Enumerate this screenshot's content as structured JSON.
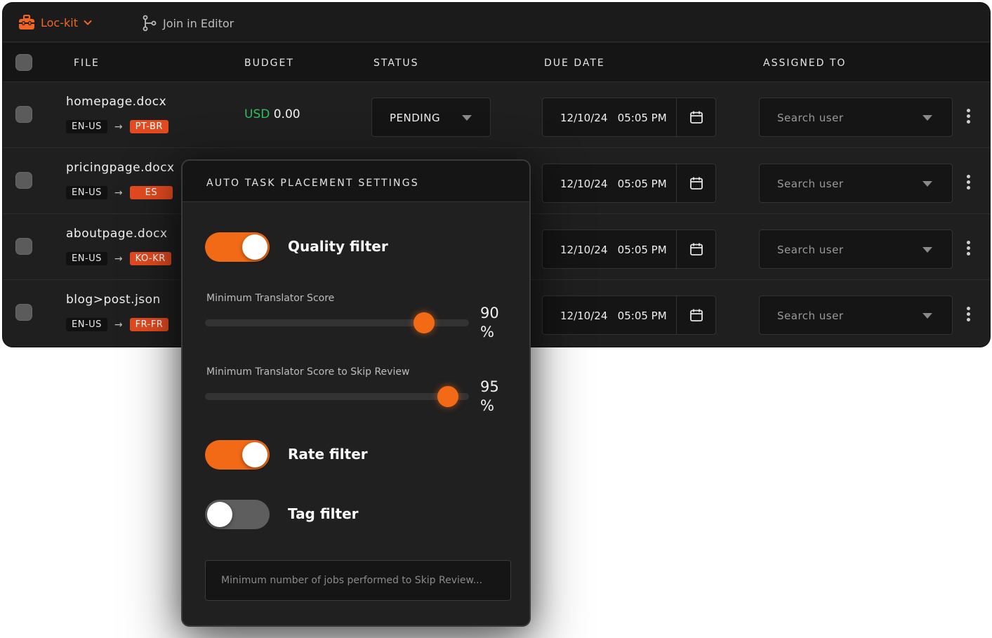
{
  "topbar": {
    "brand": "Loc-kit",
    "join": "Join in Editor"
  },
  "columns": {
    "file": "FILE",
    "budget": "BUDGET",
    "status": "STATUS",
    "due": "DUE DATE",
    "assigned": "ASSIGNED TO"
  },
  "rows": [
    {
      "file": "homepage.docx",
      "src": "EN-US",
      "tgt": "PT-BR",
      "budget_cur": "USD",
      "budget_val": "0.00",
      "status": "PENDING",
      "date": "12/10/24   05:05 PM",
      "assign": "Search user"
    },
    {
      "file": "pricingpage.docx",
      "src": "EN-US",
      "tgt": "ES",
      "date": "12/10/24   05:05 PM",
      "assign": "Search user"
    },
    {
      "file": "aboutpage.docx",
      "src": "EN-US",
      "tgt": "KO-KR",
      "date": "12/10/24   05:05 PM",
      "assign": "Search user"
    },
    {
      "file": "blog>post.json",
      "src": "EN-US",
      "tgt": "FR-FR",
      "date": "12/10/24   05:05 PM",
      "assign": "Search user"
    }
  ],
  "popover": {
    "title": "AUTO TASK PLACEMENT SETTINGS",
    "quality": {
      "label": "Quality filter",
      "on": true
    },
    "score": {
      "label": "Minimum Translator Score",
      "value": "90",
      "unit": "%",
      "fraction": 0.83
    },
    "skip": {
      "label": "Minimum Translator Score to Skip Review",
      "value": "95",
      "unit": "%",
      "fraction": 0.92
    },
    "rate": {
      "label": "Rate filter",
      "on": true
    },
    "tag": {
      "label": "Tag filter",
      "on": false
    },
    "jobs_placeholder": "Minimum number of jobs performed to Skip Review..."
  },
  "colors": {
    "accent": "#f26522",
    "budget_currency": "#2fbf5f",
    "tag_bg": "#e34a1f"
  }
}
